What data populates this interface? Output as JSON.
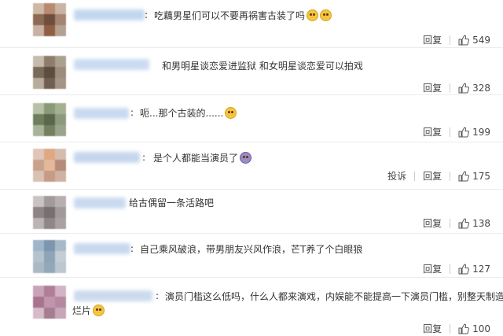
{
  "actions": {
    "reply_label": "回复",
    "report_label": "投诉"
  },
  "comments": [
    {
      "colon": ":",
      "text": "吃藕男星们可以不要再祸害古装了吗",
      "emojis": [
        "pleading-face-icon",
        "pleading-face-icon"
      ],
      "likes": "549",
      "name_color": "#bcd3ee",
      "avatar_colors": [
        "#d0b8a6",
        "#b88a72",
        "#c9b3a4",
        "#8c6a54",
        "#6e4e3c",
        "#a58474",
        "#c8b2a3",
        "#8f5f44",
        "#b5a193"
      ]
    },
    {
      "colon": ":",
      "text": "和男明星谈恋爱进监狱 和女明星谈恋爱可以拍戏",
      "emojis": [],
      "likes": "328",
      "name_color": "#c5d8ef",
      "avatar_colors": [
        "#c6bcae",
        "#8e7d6c",
        "#aaa090",
        "#7a6a5a",
        "#5c4d40",
        "#9b8c7e",
        "#b7ab9c",
        "#6f5f50",
        "#a39485"
      ]
    },
    {
      "colon": ":",
      "text": "呃...那个古装的......",
      "emojis": [
        "thinking-face-icon"
      ],
      "likes": "199",
      "name_color": "#c3d6ee",
      "avatar_colors": [
        "#b7c0a8",
        "#8a9a76",
        "#a5b092",
        "#6f7f5e",
        "#59684b",
        "#8c9a7c",
        "#a9b39a",
        "#74805f",
        "#9aa48b"
      ]
    },
    {
      "colon": ":",
      "text": "是个人都能当演员了",
      "emojis": [
        "ghost-face-icon"
      ],
      "likes": "175",
      "name_color": "#c0d3ec",
      "avatar_colors": [
        "#e0c6b8",
        "#e0a882",
        "#d6bcad",
        "#c9a28e",
        "#e4b89a",
        "#b58c79",
        "#d8c2b5",
        "#c79c86",
        "#cfb2a2"
      ]
    },
    {
      "colon": "",
      "text": "给古偶留一条活路吧",
      "emojis": [],
      "likes": "138",
      "name_color": "#c4d6ee",
      "avatar_colors": [
        "#c9c3c3",
        "#a39b9b",
        "#b8b0b0",
        "#8d8585",
        "#777070",
        "#a29a9a",
        "#bbb4b4",
        "#8f8787",
        "#aaa2a2"
      ]
    },
    {
      "colon": ":",
      "text": "自己乘风破浪，带男朋友兴风作浪，芒T养了个白眼狼",
      "emojis": [],
      "likes": "127",
      "name_color": "#c2d5ed",
      "avatar_colors": [
        "#9fb5c9",
        "#7d96ad",
        "#a8bac9",
        "#b6c3cf",
        "#8ea4b8",
        "#c4ccd4",
        "#aab9c6",
        "#93a7b9",
        "#bdc7d0"
      ]
    },
    {
      "colon": ":",
      "text": "演员门槛这么低吗，什么人都来演戏，内娱能不能提高一下演员门槛，别整天制造",
      "text2": "烂片",
      "emojis": [
        "crying-face-icon"
      ],
      "likes": "100",
      "name_color": "#c7d7ec",
      "avatar_colors": [
        "#c9a4b8",
        "#b07e98",
        "#d2b4c4",
        "#a8738e",
        "#c196ad",
        "#b58aa1",
        "#d6bccb",
        "#a57e92",
        "#c7a6b7"
      ]
    }
  ]
}
